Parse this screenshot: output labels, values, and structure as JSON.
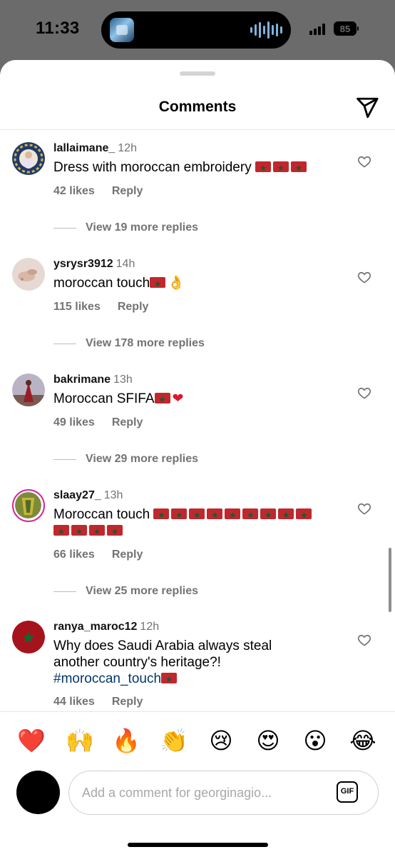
{
  "status_bar": {
    "time": "11:33",
    "battery": "85"
  },
  "header": {
    "title": "Comments"
  },
  "comments": [
    {
      "username": "lallaimane_",
      "timestamp": "12h",
      "text": "Dress with moroccan embroidery",
      "likes": "42 likes",
      "reply": "Reply",
      "view_replies": "View 19 more replies"
    },
    {
      "username": "ysrysr3912",
      "timestamp": "14h",
      "text": "moroccan touch",
      "likes": "115 likes",
      "reply": "Reply",
      "view_replies": "View 178 more replies"
    },
    {
      "username": "bakrimane",
      "timestamp": "13h",
      "text": "Moroccan SFIFA",
      "likes": "49 likes",
      "reply": "Reply",
      "view_replies": "View 29 more replies"
    },
    {
      "username": "slaay27_",
      "timestamp": "13h",
      "text": "Moroccan touch",
      "likes": "66 likes",
      "reply": "Reply",
      "view_replies": "View 25 more replies"
    },
    {
      "username": "ranya_maroc12",
      "timestamp": "12h",
      "text_line1": "Why does Saudi Arabia always steal",
      "text_line2": "another country's heritage?!",
      "hashtag": "#moroccan_touch",
      "likes": "44 likes",
      "reply": "Reply"
    }
  ],
  "reactions": [
    "❤️",
    "🙌",
    "🔥",
    "👏",
    "😢",
    "😍",
    "😮",
    "😂"
  ],
  "composer": {
    "placeholder": "Add a comment for georginagio...",
    "gif_label": "GIF"
  },
  "colors": {
    "moroccan_flag_red": "#c1272d",
    "moroccan_flag_green": "#006233",
    "hashtag": "#00376b",
    "muted_text": "#737373"
  }
}
